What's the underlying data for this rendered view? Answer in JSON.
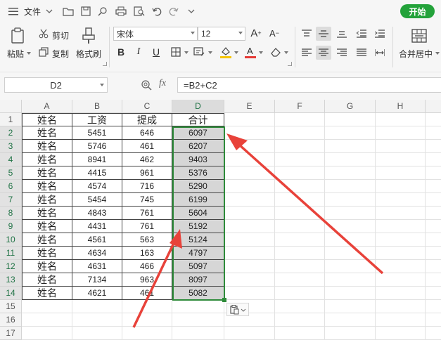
{
  "topbar": {
    "file_label": "文件",
    "start_button": "开始"
  },
  "clipboard": {
    "paste": "粘贴",
    "cut": "剪切",
    "copy": "复制",
    "format_painter": "格式刷"
  },
  "font": {
    "name": "宋体",
    "size": "12"
  },
  "alignment": {
    "merge_center": "合并居中"
  },
  "formula_bar": {
    "name_box": "D2",
    "fx": "fx",
    "formula": "=B2+C2"
  },
  "columns": [
    "A",
    "B",
    "C",
    "D",
    "E",
    "F",
    "G",
    "H"
  ],
  "rows": [
    "1",
    "2",
    "3",
    "4",
    "5",
    "6",
    "7",
    "8",
    "9",
    "10",
    "11",
    "12",
    "13",
    "14",
    "15",
    "16",
    "17"
  ],
  "table": {
    "headers": [
      "姓名",
      "工资",
      "提成",
      "合计"
    ],
    "data": [
      [
        "姓名",
        "5451",
        "646",
        "6097"
      ],
      [
        "姓名",
        "5746",
        "461",
        "6207"
      ],
      [
        "姓名",
        "8941",
        "462",
        "9403"
      ],
      [
        "姓名",
        "4415",
        "961",
        "5376"
      ],
      [
        "姓名",
        "4574",
        "716",
        "5290"
      ],
      [
        "姓名",
        "5454",
        "745",
        "6199"
      ],
      [
        "姓名",
        "4843",
        "761",
        "5604"
      ],
      [
        "姓名",
        "4431",
        "761",
        "5192"
      ],
      [
        "姓名",
        "4561",
        "563",
        "5124"
      ],
      [
        "姓名",
        "4634",
        "163",
        "4797"
      ],
      [
        "姓名",
        "4631",
        "466",
        "5097"
      ],
      [
        "姓名",
        "7134",
        "963",
        "8097"
      ],
      [
        "姓名",
        "4621",
        "461",
        "5082"
      ]
    ]
  },
  "colors": {
    "accent_green": "#23a23a",
    "selection_border": "#2e8b3a",
    "arrow_red": "#e8423a"
  }
}
